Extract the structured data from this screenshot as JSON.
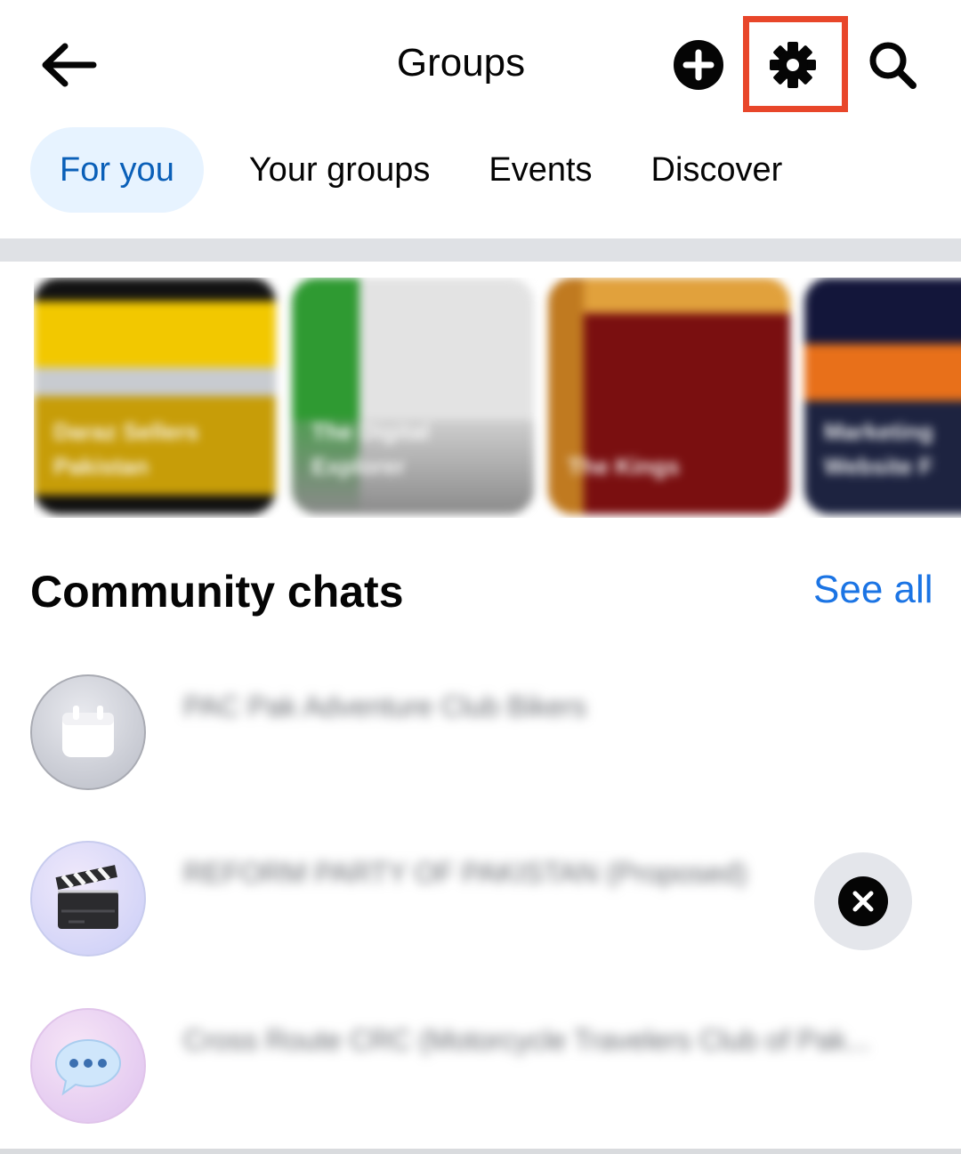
{
  "header": {
    "title": "Groups",
    "back_icon": "arrow-left-icon",
    "add_icon": "plus-circle-icon",
    "settings_icon": "gear-icon",
    "search_icon": "search-icon",
    "highlight_color": "#e8462a"
  },
  "tabs": [
    {
      "label": "For you",
      "active": true
    },
    {
      "label": "Your groups",
      "active": false
    },
    {
      "label": "Events",
      "active": false
    },
    {
      "label": "Discover",
      "active": false
    }
  ],
  "group_cards": [
    {
      "label": "Daraz Sellers Pakistan"
    },
    {
      "label": "The Digital Explorer"
    },
    {
      "label": "The Kings"
    },
    {
      "label": "Marketing Website F"
    }
  ],
  "community_chats": {
    "title": "Community chats",
    "see_all": "See all",
    "items": [
      {
        "name": "PAC Pak Adventure Club Bikers",
        "icon": "calendar-icon"
      },
      {
        "name": "REFORM PARTY OF PAKISTAN (Proposed)",
        "icon": "clapperboard-icon"
      },
      {
        "name": "Cross Route CRC (Motorcycle Travelers Club of Pak...",
        "icon": "speech-bubble-icon"
      }
    ]
  },
  "floating": {
    "close_icon": "close-icon"
  },
  "colors": {
    "accent": "#1b74e4",
    "tab_active_bg": "#e7f3ff",
    "tab_active_text": "#0a5fb8"
  }
}
